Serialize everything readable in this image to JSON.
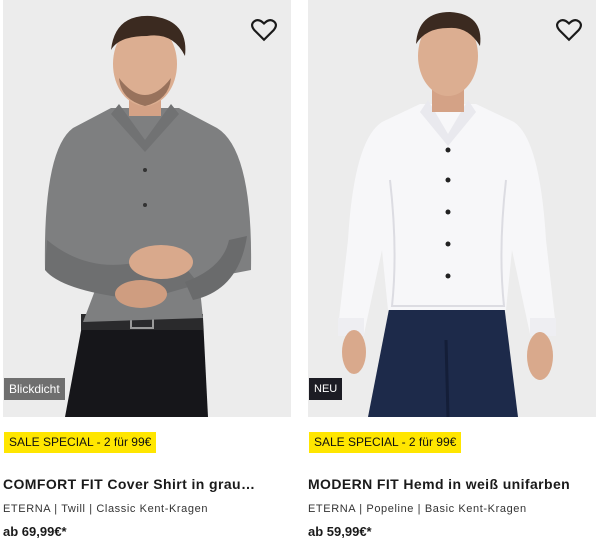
{
  "products": [
    {
      "badge": "Blickdicht",
      "promo": "SALE SPECIAL - 2 für 99€",
      "title": "COMFORT FIT Cover Shirt in grau…",
      "brand": "ETERNA",
      "fabric": "Twill",
      "collar": "Classic Kent-Kragen",
      "price": "ab 69,99€*",
      "favorite_icon": "heart-outline-icon",
      "shirt_color": "#7e7f80"
    },
    {
      "badge": "NEU",
      "promo": "SALE SPECIAL - 2 für 99€",
      "title": "MODERN FIT Hemd in weiß unifarben",
      "brand": "ETERNA",
      "fabric": "Popeline",
      "collar": "Basic Kent-Kragen",
      "price": "ab 59,99€*",
      "favorite_icon": "heart-outline-icon",
      "shirt_color": "#f7f7f9"
    }
  ],
  "meta_separator": " | ",
  "colors": {
    "promo_bg": "#ffe600",
    "image_bg": "#ececec",
    "badge_grey": "#6f6f6f",
    "badge_dark": "#1c1c24"
  }
}
